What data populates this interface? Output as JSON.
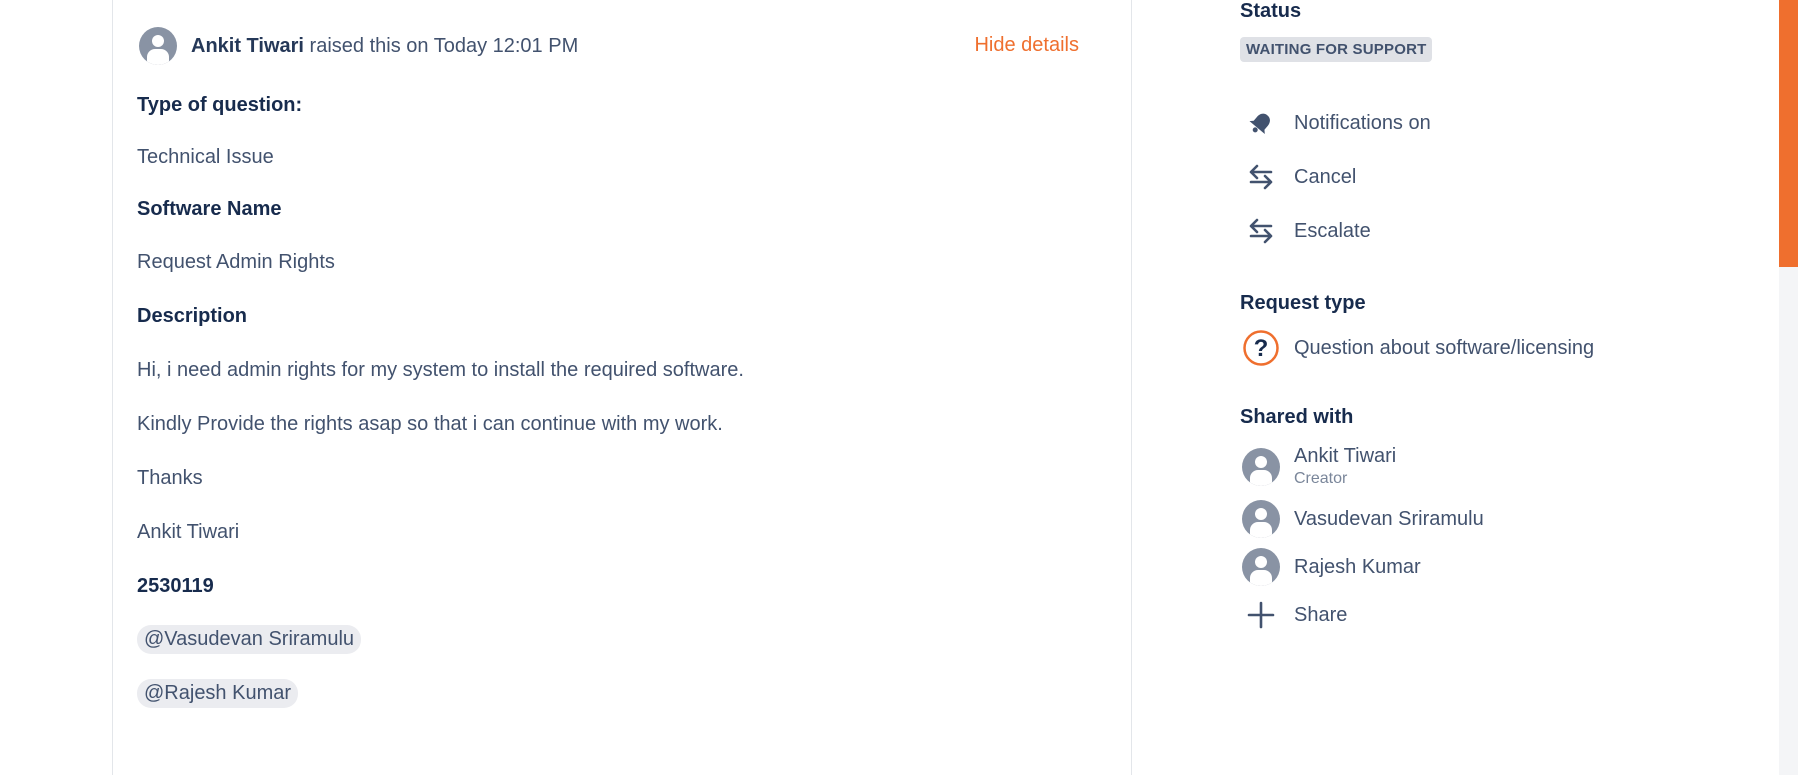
{
  "request": {
    "raised_by": "Ankit Tiwari",
    "raised_suffix": " raised this on Today 12:01 PM",
    "hide_details": "Hide details",
    "fields": [
      {
        "text": "Type of question:",
        "bold": true
      },
      {
        "text": "Technical Issue",
        "bold": false
      },
      {
        "text": "Software Name",
        "bold": true
      },
      {
        "text": "Request Admin Rights",
        "bold": false
      },
      {
        "text": "Description",
        "bold": true
      },
      {
        "text": "Hi, i need admin rights for my system to install the required software.",
        "bold": false
      },
      {
        "text": "Kindly Provide the rights asap so that i can continue with my work.",
        "bold": false
      },
      {
        "text": "Thanks",
        "bold": false
      },
      {
        "text": "Ankit Tiwari",
        "bold": false
      },
      {
        "text": "2530119",
        "bold": true
      }
    ],
    "mentions": [
      "@Vasudevan Sriramulu",
      "@Rajesh Kumar"
    ]
  },
  "sidebar": {
    "status_title": "Status",
    "status_value": "WAITING FOR SUPPORT",
    "actions": [
      {
        "label": "Notifications on",
        "icon": "notification-bell-icon"
      },
      {
        "label": "Cancel",
        "icon": "transition-arrows-icon"
      },
      {
        "label": "Escalate",
        "icon": "transition-arrows-icon"
      }
    ],
    "request_type_title": "Request type",
    "request_type_value": "Question about software/licensing",
    "request_type_icon": "question-icon",
    "shared_title": "Shared with",
    "shared": [
      {
        "name": "Ankit Tiwari",
        "role": "Creator"
      },
      {
        "name": "Vasudevan Sriramulu",
        "role": ""
      },
      {
        "name": "Rajesh Kumar",
        "role": ""
      }
    ],
    "share_label": "Share",
    "share_icon": "plus-icon"
  },
  "colors": {
    "accent": "#ef6f2e",
    "text": "#172b4d",
    "muted": "#42526e",
    "lozenge_bg": "#dfe1e6"
  }
}
